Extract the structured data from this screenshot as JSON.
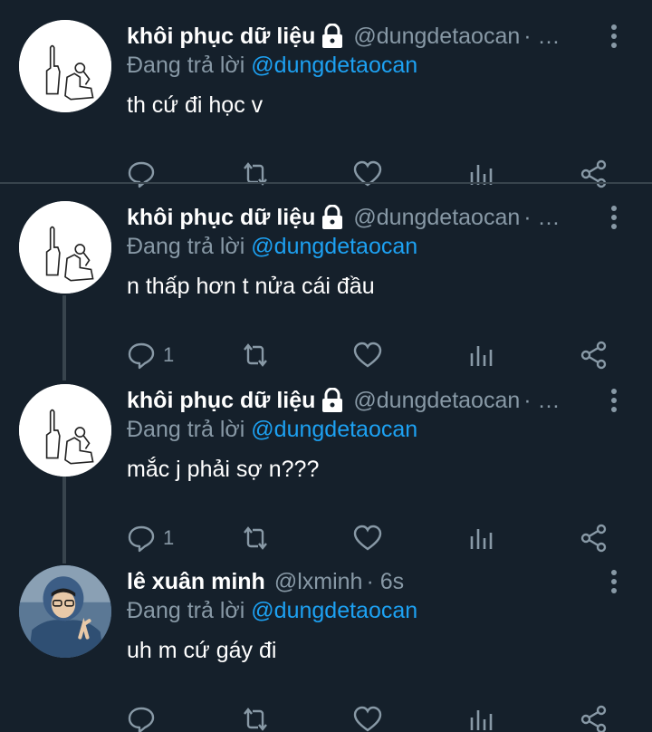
{
  "tweets": [
    {
      "display_name": "khôi phục dữ liệu",
      "handle": "@dungdetaocan",
      "time": "· …",
      "locked": true,
      "reply_prefix": "Đang trả lời",
      "reply_to": "@dungdetaocan",
      "text": "th cứ đi học v",
      "reply_count": "",
      "avatar": "drawing-avatar"
    },
    {
      "display_name": "khôi phục dữ liệu",
      "handle": "@dungdetaocan",
      "time": "· …",
      "locked": true,
      "reply_prefix": "Đang trả lời",
      "reply_to": "@dungdetaocan",
      "text": "n thấp hơn t nửa cái đầu",
      "reply_count": "1",
      "avatar": "drawing-avatar"
    },
    {
      "display_name": "khôi phục dữ liệu",
      "handle": "@dungdetaocan",
      "time": "· …",
      "locked": true,
      "reply_prefix": "Đang trả lời",
      "reply_to": "@dungdetaocan",
      "text": "mắc j phải sợ n???",
      "reply_count": "1",
      "avatar": "drawing-avatar"
    },
    {
      "display_name": "lê xuân minh",
      "handle": "@lxminh",
      "time": "· 6s",
      "locked": false,
      "reply_prefix": "Đang trả lời",
      "reply_to": "@dungdetaocan",
      "text": "uh m cứ gáy đi",
      "reply_count": "",
      "avatar": "photo-avatar"
    }
  ],
  "icons": [
    "reply-icon",
    "retweet-icon",
    "like-icon",
    "analytics-icon",
    "share-icon",
    "lock-icon",
    "more-icon"
  ],
  "colors": {
    "background": "#15202b",
    "divider": "#38444d",
    "text": "#ffffff",
    "secondary_text": "#8899a6",
    "link": "#1da1f2"
  }
}
